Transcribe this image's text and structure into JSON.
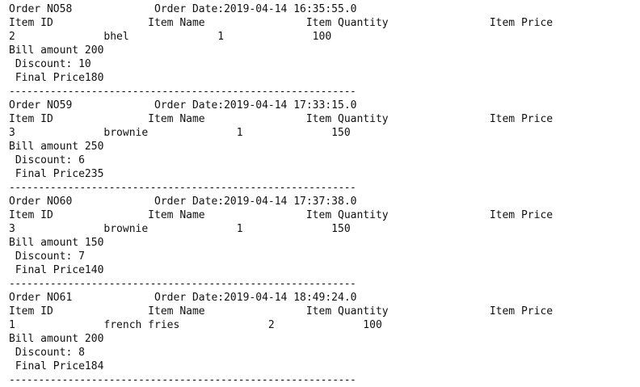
{
  "orders": [
    {
      "header": "Order NO58             Order Date:2019-04-14 16:35:55.0",
      "columns": "Item ID               Item Name                Item Quantity                Item Price",
      "item_row": "2              bhel              1              100",
      "bill": "Bill amount 200",
      "discount": " Discount: 10",
      "final": " Final Price180",
      "separator": "-----------------------------------------------------------"
    },
    {
      "header": "Order NO59             Order Date:2019-04-14 17:33:15.0",
      "columns": "Item ID               Item Name                Item Quantity                Item Price",
      "item_row": "3              brownie              1              150",
      "bill": "Bill amount 250",
      "discount": " Discount: 6",
      "final": " Final Price235",
      "separator": "-----------------------------------------------------------"
    },
    {
      "header": "Order NO60             Order Date:2019-04-14 17:37:38.0",
      "columns": "Item ID               Item Name                Item Quantity                Item Price",
      "item_row": "3              brownie              1              150",
      "bill": "Bill amount 150",
      "discount": " Discount: 7",
      "final": " Final Price140",
      "separator": "-----------------------------------------------------------"
    },
    {
      "header": "Order NO61             Order Date:2019-04-14 18:49:24.0",
      "columns": "Item ID               Item Name                Item Quantity                Item Price",
      "item_row": "1              french fries              2              100",
      "bill": "Bill amount 200",
      "discount": " Discount: 8",
      "final": " Final Price184",
      "separator": "-----------------------------------------------------------"
    }
  ]
}
